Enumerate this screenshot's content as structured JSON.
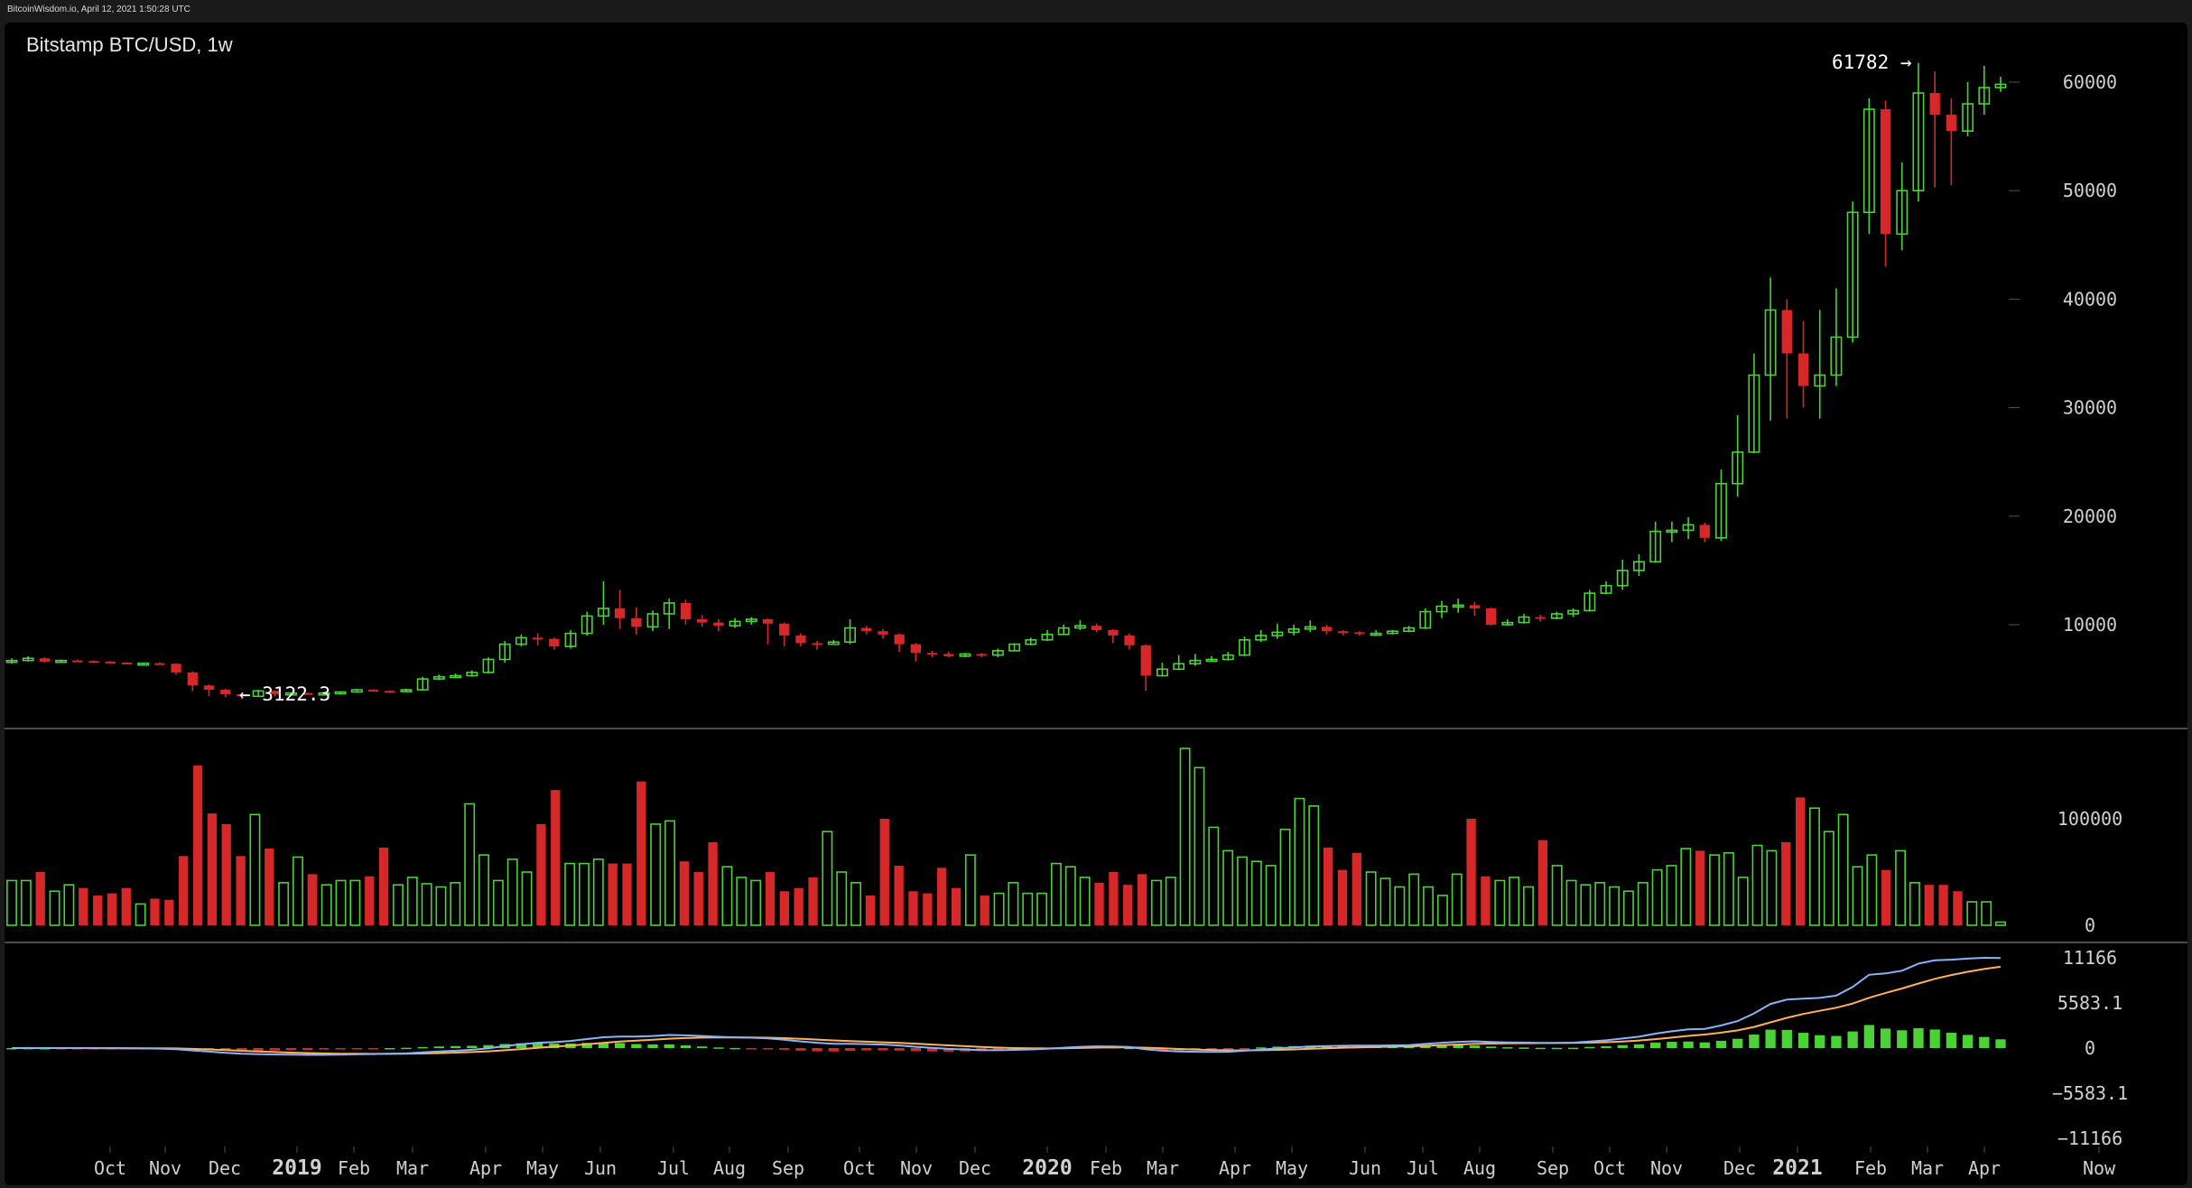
{
  "window": {
    "status_text": "BitcoinWisdom.io, April 12, 2021 1:50:28 UTC"
  },
  "chart": {
    "title": "Bitstamp BTC/USD, 1w",
    "high_label": "61782 →",
    "low_label": "← 3122.3",
    "colors": {
      "up": "#4cd137",
      "down": "#d62828",
      "ma_fast": "#8ab4f8",
      "ma_slow": "#ffb15c",
      "grid": "#222",
      "axis_text": "#d0d0d0"
    }
  },
  "chart_data": [
    {
      "type": "candlestick",
      "title": "Bitstamp BTC/USD, 1w",
      "ylim": [
        0,
        64000
      ],
      "y_ticks": [
        10000,
        20000,
        30000,
        40000,
        50000,
        60000
      ],
      "x_tick_labels": [
        {
          "label": "Oct",
          "bold": false
        },
        {
          "label": "Nov",
          "bold": false
        },
        {
          "label": "Dec",
          "bold": false
        },
        {
          "label": "2019",
          "bold": true
        },
        {
          "label": "Feb",
          "bold": false
        },
        {
          "label": "Mar",
          "bold": false
        },
        {
          "label": "Apr",
          "bold": false
        },
        {
          "label": "May",
          "bold": false
        },
        {
          "label": "Jun",
          "bold": false
        },
        {
          "label": "Jul",
          "bold": false
        },
        {
          "label": "Aug",
          "bold": false
        },
        {
          "label": "Sep",
          "bold": false
        },
        {
          "label": "Oct",
          "bold": false
        },
        {
          "label": "Nov",
          "bold": false
        },
        {
          "label": "Dec",
          "bold": false
        },
        {
          "label": "2020",
          "bold": true
        },
        {
          "label": "Feb",
          "bold": false
        },
        {
          "label": "Mar",
          "bold": false
        },
        {
          "label": "Apr",
          "bold": false
        },
        {
          "label": "May",
          "bold": false
        },
        {
          "label": "Jun",
          "bold": false
        },
        {
          "label": "Jul",
          "bold": false
        },
        {
          "label": "Aug",
          "bold": false
        },
        {
          "label": "Sep",
          "bold": false
        },
        {
          "label": "Oct",
          "bold": false
        },
        {
          "label": "Nov",
          "bold": false
        },
        {
          "label": "Dec",
          "bold": false
        },
        {
          "label": "2021",
          "bold": true
        },
        {
          "label": "Feb",
          "bold": false
        },
        {
          "label": "Mar",
          "bold": false
        },
        {
          "label": "Apr",
          "bold": false
        },
        {
          "label": "Now",
          "bold": false
        }
      ],
      "close": [
        6700,
        6900,
        6600,
        6700,
        6650,
        6600,
        6500,
        6450,
        6450,
        6400,
        5600,
        4400,
        4000,
        3600,
        3400,
        3900,
        3600,
        3700,
        3600,
        3700,
        3800,
        4000,
        3900,
        3850,
        4000,
        5000,
        5200,
        5300,
        5600,
        6800,
        8200,
        8800,
        8700,
        8000,
        9200,
        10800,
        11500,
        10600,
        9800,
        11000,
        12000,
        10500,
        10200,
        9900,
        10300,
        10500,
        10100,
        9000,
        8300,
        8200,
        8400,
        9700,
        9400,
        9100,
        8200,
        7400,
        7300,
        7100,
        7300,
        7200,
        7600,
        8200,
        8600,
        9100,
        9700,
        9900,
        9500,
        9000,
        8100,
        5300,
        5900,
        6400,
        6700,
        6800,
        7200,
        8600,
        9000,
        9300,
        9600,
        9800,
        9400,
        9300,
        9200,
        9200,
        9400,
        9700,
        11200,
        11700,
        11800,
        11500,
        10000,
        10200,
        10700,
        10600,
        11000,
        11300,
        12900,
        13600,
        15000,
        15800,
        18600,
        18700,
        19200,
        18000,
        23000,
        25900,
        33000,
        39000,
        35000,
        32000,
        33000,
        36500,
        48000,
        57500,
        46000,
        50000,
        59000,
        57000,
        55500,
        58000,
        59500,
        59800
      ],
      "open": [
        6600,
        6700,
        6900,
        6600,
        6700,
        6650,
        6600,
        6500,
        6450,
        6450,
        6400,
        5600,
        4400,
        4000,
        3600,
        3400,
        3900,
        3600,
        3700,
        3600,
        3700,
        3800,
        4000,
        3900,
        3850,
        4000,
        5000,
        5200,
        5300,
        5600,
        6800,
        8200,
        8800,
        8700,
        8000,
        9200,
        10800,
        11500,
        10600,
        9800,
        11000,
        12000,
        10500,
        10200,
        9900,
        10300,
        10500,
        10100,
        9000,
        8300,
        8200,
        8400,
        9700,
        9400,
        9100,
        8200,
        7400,
        7300,
        7100,
        7300,
        7200,
        7600,
        8200,
        8600,
        9100,
        9700,
        9900,
        9500,
        9000,
        8100,
        5300,
        5900,
        6400,
        6700,
        6800,
        7200,
        8600,
        9000,
        9300,
        9600,
        9800,
        9400,
        9300,
        9200,
        9200,
        9400,
        9700,
        11200,
        11700,
        11800,
        11500,
        10000,
        10200,
        10700,
        10600,
        11000,
        11300,
        12900,
        13600,
        15000,
        15800,
        18600,
        18700,
        19200,
        18000,
        23000,
        25900,
        33000,
        39000,
        35000,
        32000,
        33000,
        36500,
        48000,
        57500,
        46000,
        50000,
        59000,
        57000,
        55500,
        58000,
        59500
      ],
      "high": [
        6900,
        7100,
        7000,
        6800,
        6800,
        6700,
        6650,
        6550,
        6500,
        6500,
        6450,
        5700,
        4500,
        4100,
        3700,
        4000,
        3950,
        3750,
        3750,
        3750,
        3850,
        4100,
        4050,
        3950,
        4100,
        5200,
        5400,
        5500,
        5800,
        7000,
        8500,
        9100,
        9200,
        8800,
        9500,
        11200,
        14000,
        13200,
        11600,
        11300,
        12400,
        12300,
        10900,
        10500,
        10600,
        10700,
        10600,
        10200,
        9200,
        8500,
        8600,
        10500,
        9900,
        9600,
        9200,
        8300,
        7600,
        7500,
        7400,
        7400,
        7800,
        8300,
        8800,
        9500,
        10000,
        10400,
        10100,
        9600,
        9200,
        8200,
        6500,
        7200,
        7300,
        7100,
        7500,
        8900,
        9500,
        10100,
        10000,
        10400,
        10000,
        9500,
        9400,
        9500,
        9500,
        9900,
        11500,
        12200,
        12400,
        12100,
        11600,
        10500,
        11000,
        10900,
        11200,
        11500,
        13200,
        14000,
        16000,
        16500,
        19500,
        19500,
        19900,
        19400,
        24300,
        29300,
        35000,
        42000,
        40000,
        38000,
        39000,
        41000,
        49000,
        58500,
        58300,
        52600,
        61782,
        61000,
        58500,
        60000,
        61500,
        60500
      ],
      "low": [
        6400,
        6600,
        6500,
        6500,
        6550,
        6500,
        6400,
        6350,
        6350,
        6300,
        5400,
        3900,
        3400,
        3300,
        3122.3,
        3400,
        3400,
        3550,
        3550,
        3550,
        3650,
        3850,
        3850,
        3750,
        3800,
        3950,
        4900,
        5100,
        5200,
        5500,
        6500,
        8000,
        8100,
        7700,
        7800,
        9000,
        10000,
        9600,
        9100,
        9400,
        9600,
        10000,
        9800,
        9400,
        9700,
        10000,
        8200,
        8000,
        8000,
        7700,
        8200,
        8200,
        9100,
        8700,
        7500,
        6600,
        7000,
        7000,
        7000,
        7000,
        7000,
        7600,
        8100,
        8500,
        9100,
        9500,
        9300,
        8300,
        7700,
        3900,
        5200,
        5800,
        6200,
        6600,
        6700,
        7100,
        8400,
        8700,
        9000,
        9300,
        9100,
        9000,
        9000,
        9000,
        9100,
        9300,
        9600,
        10600,
        11100,
        10800,
        9900,
        9900,
        10100,
        10300,
        10500,
        10700,
        11200,
        12800,
        13200,
        14500,
        15700,
        17600,
        17900,
        17600,
        17700,
        21800,
        25800,
        28800,
        29000,
        30000,
        29000,
        32000,
        36000,
        46000,
        43000,
        44500,
        49000,
        50300,
        50500,
        55000,
        57000,
        59100
      ],
      "volume": [
        42000,
        42000,
        50000,
        32000,
        38000,
        35000,
        28000,
        30000,
        35000,
        20000,
        25000,
        24000,
        65000,
        150000,
        105000,
        95000,
        65000,
        104000,
        72000,
        40000,
        64000,
        48000,
        38000,
        42000,
        42000,
        46000,
        73000,
        38000,
        45000,
        39000,
        36000,
        40000,
        114000,
        66000,
        42000,
        62000,
        50000,
        95000,
        127000,
        58000,
        58000,
        62000,
        58000,
        58000,
        135000,
        95000,
        98000,
        60000,
        50000,
        78000,
        55000,
        45000,
        42000,
        50000,
        32000,
        35000,
        45000,
        88000,
        50000,
        40000,
        28000,
        100000,
        56000,
        32000,
        30000,
        54000,
        35000,
        66000,
        28000,
        30000,
        40000,
        30000,
        30000,
        58000,
        55000,
        45000,
        40000,
        50000,
        38000,
        48000,
        42000,
        45000,
        166000,
        148000,
        92000,
        70000,
        64000,
        60000,
        56000,
        90000,
        119000,
        112000,
        73000,
        52000,
        68000,
        50000,
        44000,
        36000,
        48000,
        36000,
        28000,
        48000,
        100000,
        46000,
        42000,
        45000,
        36000,
        80000,
        56000,
        42000,
        38000,
        40000,
        36000,
        32000,
        40000,
        52000,
        56000,
        72000,
        70000,
        66000,
        68000,
        45000,
        75000,
        70000,
        78000,
        120000,
        110000,
        88000,
        104000,
        55000,
        66000,
        52000,
        70000,
        40000,
        38000,
        38000,
        32000,
        22000,
        22000,
        3000
      ],
      "volume_ylim": [
        0,
        170000
      ],
      "volume_ticks": [
        0,
        100000
      ],
      "macd_ylim": [
        -12500,
        12500
      ],
      "macd_ticks": [
        11166,
        5583.1,
        0,
        -5583.1,
        -11166
      ],
      "macd_tick_labels": [
        "11166",
        "5583.1",
        "0",
        "−5583.1",
        "−11166"
      ]
    }
  ]
}
